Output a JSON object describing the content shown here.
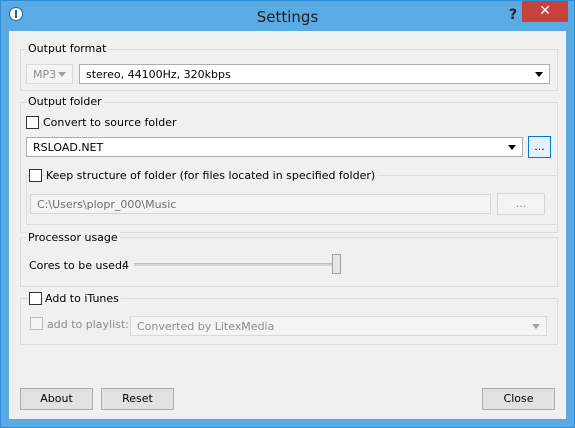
{
  "window": {
    "title": "Settings",
    "help": "?",
    "close": "✕"
  },
  "output_format": {
    "group_label": "Output format",
    "format_value": "MP3",
    "quality_value": "stereo, 44100Hz, 320kbps"
  },
  "output_folder": {
    "group_label": "Output folder",
    "convert_to_source_label": "Convert to source folder",
    "folder_value": "RSLOAD.NET",
    "browse_label": "...",
    "keep_structure_label": "Keep structure of folder (for files located in specified folder)",
    "path_value": "C:\\Users\\plopr_000\\Music",
    "path_browse_label": "..."
  },
  "processor_usage": {
    "group_label": "Processor usage",
    "cores_label": "Cores to be used:",
    "cores_value": "4",
    "slider_fraction": 1.0
  },
  "itunes": {
    "add_label": "Add to iTunes",
    "add_playlist_label": "add to playlist:",
    "playlist_value": "Converted by LitexMedia"
  },
  "footer": {
    "about_label": "About",
    "reset_label": "Reset",
    "close_label": "Close"
  }
}
